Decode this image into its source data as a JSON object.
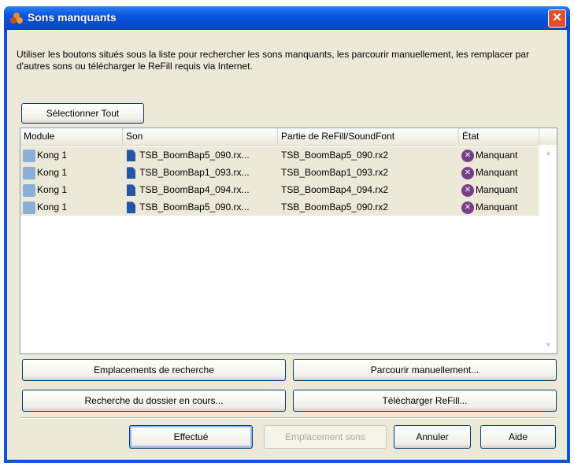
{
  "window": {
    "title": "Sons manquants",
    "close": "✕"
  },
  "description": "Utiliser les boutons situés sous la liste pour rechercher les sons manquants, les parcourir manuellement, les remplacer par d'autres sons ou télécharger le ReFill requis via Internet.",
  "select_all": "Sélectionner Tout",
  "columns": [
    "Module",
    "Son",
    "Partie de ReFill/SoundFont",
    "État"
  ],
  "rows": [
    {
      "module": "Kong 1",
      "son": "TSB_BoomBap5_090.rx...",
      "partie": "TSB_BoomBap5_090.rx2",
      "etat": "Manquant"
    },
    {
      "module": "Kong 1",
      "son": "TSB_BoomBap1_093.rx...",
      "partie": "TSB_BoomBap1_093.rx2",
      "etat": "Manquant"
    },
    {
      "module": "Kong 1",
      "son": "TSB_BoomBap4_094.rx...",
      "partie": "TSB_BoomBap4_094.rx2",
      "etat": "Manquant"
    },
    {
      "module": "Kong 1",
      "son": "TSB_BoomBap5_090.rx...",
      "partie": "TSB_BoomBap5_090.rx2",
      "etat": "Manquant"
    }
  ],
  "actions": {
    "search_locations": "Emplacements de recherche",
    "browse": "Parcourir manuellement...",
    "search_folder": "Recherche du dossier en cours...",
    "download": "Télécharger ReFill..."
  },
  "footer": {
    "done": "Effectué",
    "sound_location": "Emplacement sons",
    "cancel": "Annuler",
    "help": "Aide"
  }
}
